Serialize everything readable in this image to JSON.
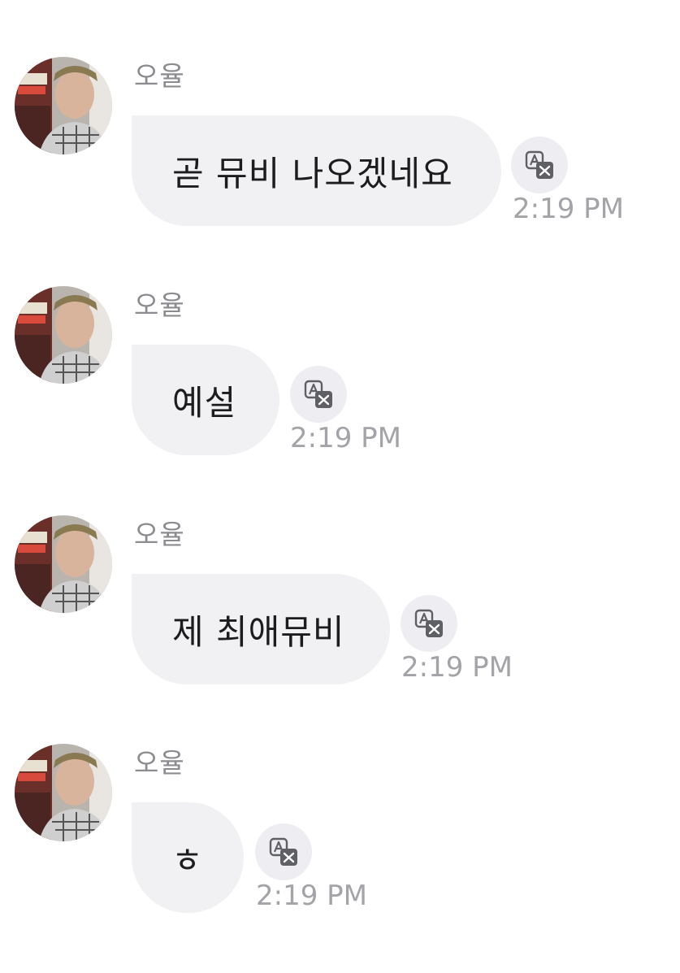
{
  "colors": {
    "bubble_bg": "#f1f1f4",
    "text": "#1c1c1e",
    "meta_text": "#8b8b90",
    "timestamp": "#a3a3a8",
    "icon": "#5f5f66"
  },
  "messages": [
    {
      "sender": "오율",
      "text": "곧 뮤비 나오겠네요",
      "time": "2:19 PM",
      "icons": {
        "avatar": "profile-photo",
        "action": "translate-icon"
      }
    },
    {
      "sender": "오율",
      "text": "예설",
      "time": "2:19 PM",
      "icons": {
        "avatar": "profile-photo",
        "action": "translate-icon"
      }
    },
    {
      "sender": "오율",
      "text": "제 최애뮤비",
      "time": "2:19 PM",
      "icons": {
        "avatar": "profile-photo",
        "action": "translate-icon"
      }
    },
    {
      "sender": "오율",
      "text": "ㅎ",
      "time": "2:19 PM",
      "icons": {
        "avatar": "profile-photo",
        "action": "translate-icon"
      }
    }
  ]
}
